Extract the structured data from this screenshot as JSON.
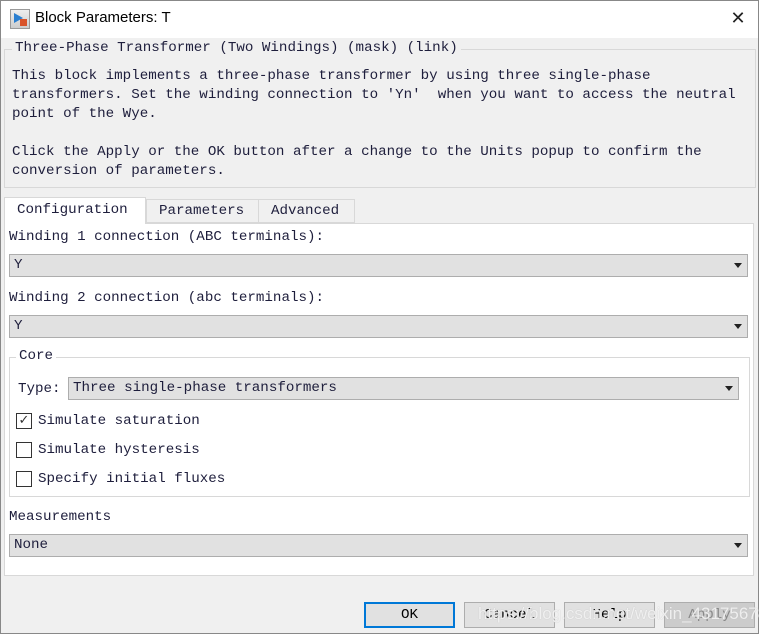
{
  "window": {
    "title": "Block Parameters: T",
    "icon": "simulink-block-icon",
    "close_icon": "close-icon"
  },
  "description": {
    "legend": "Three-Phase Transformer (Two Windings) (mask) (link)",
    "lines": [
      "This block implements a three-phase transformer by using three single-phase",
      "transformers. Set the winding connection to 'Yn'  when you want to access the neutral",
      "point of the Wye.",
      "",
      "Click the Apply or the OK button after a change to the Units popup to confirm the",
      "conversion of parameters."
    ]
  },
  "tabs": [
    {
      "label": "Configuration",
      "active": true
    },
    {
      "label": "Parameters",
      "active": false
    },
    {
      "label": "Advanced",
      "active": false
    }
  ],
  "config": {
    "winding1": {
      "label": "Winding 1 connection (ABC terminals):",
      "value": "Y"
    },
    "winding2": {
      "label": "Winding 2 connection (abc terminals):",
      "value": "Y"
    },
    "core": {
      "legend": "Core",
      "type_label": "Type:",
      "type_value": "Three single-phase transformers",
      "checkboxes": [
        {
          "label": "Simulate saturation",
          "checked": true
        },
        {
          "label": "Simulate hysteresis",
          "checked": false
        },
        {
          "label": "Specify initial fluxes",
          "checked": false
        }
      ]
    },
    "measurements": {
      "label": "Measurements",
      "value": "None"
    }
  },
  "buttons": {
    "ok": "OK",
    "cancel": "Cancel",
    "help": "Help",
    "apply": "Apply"
  },
  "watermark": "https://blog.csdn.net/weixin_43175678"
}
